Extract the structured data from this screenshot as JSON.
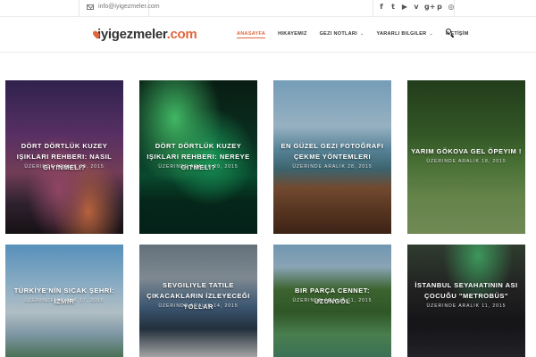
{
  "topbar": {
    "email": "info@iyigezmeler.com",
    "social_icons": [
      "facebook-icon",
      "twitter-icon",
      "youtube-icon",
      "vimeo-icon",
      "google-plus-icon",
      "pinterest-icon",
      "instagram-icon"
    ],
    "social_glyphs": [
      "f",
      "t",
      "▶",
      "v",
      "g+",
      "p",
      "◎"
    ]
  },
  "header": {
    "logo_main": "iyigezmeler",
    "logo_suffix": ".com",
    "nav": [
      {
        "label": "ANASAYFA",
        "active": true,
        "caret": ""
      },
      {
        "label": "HIKAYEMIZ",
        "active": false,
        "caret": ""
      },
      {
        "label": "GEZI NOTLARI",
        "active": false,
        "caret": "⌄"
      },
      {
        "label": "YARARLI BILGILER",
        "active": false,
        "caret": "⌄"
      },
      {
        "label": "İLETİŞİM",
        "active": false,
        "caret": ""
      }
    ]
  },
  "posts": [
    {
      "title": "DÖRT DÖRTLÜK KUZEY IŞIKLARI REHBERI: NASIL GIYINMELI?",
      "meta": "ÜZERINDE ARALIK 30, 2015"
    },
    {
      "title": "DÖRT DÖRTLÜK KUZEY IŞIKLARI REHBERI: NEREYE GITMELI?",
      "meta": "ÜZERINDE ARALIK 29, 2015"
    },
    {
      "title": "EN GÜZEL GEZI FOTOĞRAFI ÇEKME YÖNTEMLERI",
      "meta": "ÜZERINDE ARALIK 28, 2015"
    },
    {
      "title": "YARIM GÖKOVA GEL ÖPEYIM !",
      "meta": "ÜZERINDE ARALIK 18, 2015"
    },
    {
      "title": "TÜRKİYE'NİN SICAK ŞEHRİ: İZMİR",
      "meta": "ÜZERINDE ARALIK 17, 2015"
    },
    {
      "title": "SEVGILIYLE TATILE ÇIKACAKLARIN İZLEYECEĞI YOLLAR",
      "meta": "ÜZERINDE ARALIK 14, 2015"
    },
    {
      "title": "BIR PARÇA CENNET: UZUNGÖL",
      "meta": "ÜZERINDE ARALIK 11, 2015"
    },
    {
      "title": "İSTANBUL SEYAHATININ ASI ÇOCUĞU \"METROBÜS\"",
      "meta": "ÜZERINDE ARALIK 11, 2015"
    }
  ],
  "colors": {
    "accent": "#e0663d"
  }
}
